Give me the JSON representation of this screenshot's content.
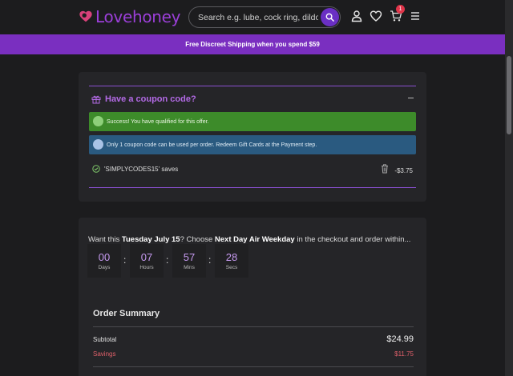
{
  "header": {
    "logo_text": "Lovehoney",
    "search_placeholder": "Search e.g. lube, cock ring, dildo",
    "cart_count": "1",
    "icons": [
      "search-icon",
      "account-icon",
      "heart-icon",
      "cart-icon",
      "menu-icon"
    ]
  },
  "promo": {
    "text": "Free Discreet Shipping when you spend $59"
  },
  "coupon": {
    "title": "Have a coupon code?",
    "success_message": "Success! You have qualified for this offer.",
    "info_message": "Only 1 coupon code can be used per order. Redeem Gift Cards at the Payment step.",
    "code_text": "'SIMPLYCODES15' saves",
    "discount": "-$3.75"
  },
  "delivery": {
    "prefix": "Want this ",
    "date": "Tuesday July 15",
    "mid": "? Choose ",
    "method": "Next Day Air Weekday",
    "suffix": " in the checkout and order within...",
    "timer": [
      {
        "value": "00",
        "label": "Days"
      },
      {
        "value": "07",
        "label": "Hours"
      },
      {
        "value": "57",
        "label": "Mins"
      },
      {
        "value": "28",
        "label": "Secs"
      }
    ]
  },
  "summary": {
    "title": "Order Summary",
    "subtotal_label": "Subtotal",
    "subtotal_value": "$24.99",
    "savings_label": "Savings",
    "savings_value": "$11.75"
  },
  "colors": {
    "brand_purple": "#9b3fd8",
    "promo_bg": "#7a2fc0",
    "success_bg": "#3d8b2a",
    "info_bg": "#2a5a80",
    "savings_red": "#e0606a"
  }
}
